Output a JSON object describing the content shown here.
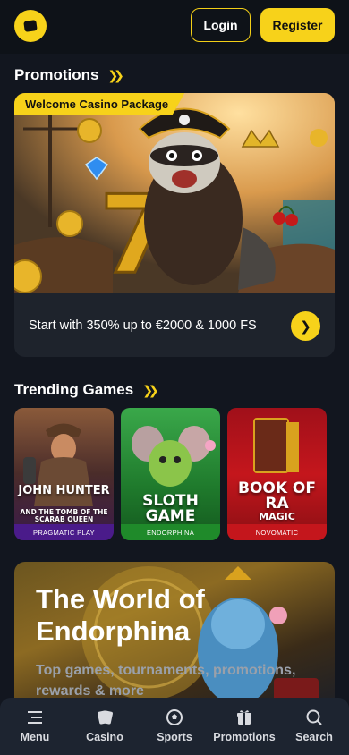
{
  "header": {
    "login_label": "Login",
    "register_label": "Register"
  },
  "promotions": {
    "title": "Promotions",
    "card": {
      "tag": "Welcome Casino Package",
      "text": "Start with 350% up to €2000 & 1000 FS"
    }
  },
  "trending": {
    "title": "Trending Games",
    "games": [
      {
        "title": "JOHN HUNTER",
        "subtitle": "AND THE TOMB OF THE SCARAB QUEEN",
        "provider": "PRAGMATIC PLAY"
      },
      {
        "title": "SLOTH GAME",
        "provider": "ENDORPHINA"
      },
      {
        "title": "BOOK OF RA",
        "subtitle": "MAGIC",
        "provider": "NOVOMATIC"
      }
    ]
  },
  "banner": {
    "title": "The World of Endorphina",
    "text": "Top games, tournaments, promotions, rewards & more"
  },
  "bottom_nav": {
    "items": [
      {
        "label": "Menu",
        "icon": "menu-icon"
      },
      {
        "label": "Casino",
        "icon": "casino-icon"
      },
      {
        "label": "Sports",
        "icon": "sports-ball-icon"
      },
      {
        "label": "Promotions",
        "icon": "gift-icon"
      },
      {
        "label": "Search",
        "icon": "search-icon"
      }
    ]
  },
  "colors": {
    "accent": "#f7d21a",
    "background": "#12161f",
    "card": "#1e232c"
  }
}
